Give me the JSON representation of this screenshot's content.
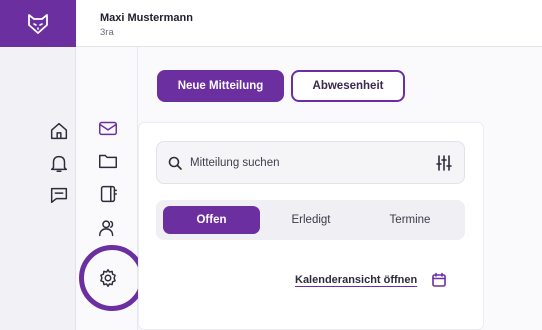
{
  "brand": {
    "logo_icon": "fox-logo-icon",
    "accent_color": "#6b2fa0"
  },
  "header": {
    "user_name": "Maxi Mustermann",
    "user_class": "3ra"
  },
  "rail_primary": [
    {
      "icon": "home-icon"
    },
    {
      "icon": "bell-icon"
    },
    {
      "icon": "chat-icon"
    }
  ],
  "rail_secondary": [
    {
      "icon": "mail-icon",
      "active": true
    },
    {
      "icon": "folder-icon"
    },
    {
      "icon": "notebook-icon"
    },
    {
      "icon": "users-icon"
    },
    {
      "icon": "gear-icon",
      "highlighted": true
    }
  ],
  "actions": {
    "new_message": "Neue Mitteilung",
    "absence": "Abwesenheit"
  },
  "search": {
    "placeholder": "Mitteilung suchen",
    "value": ""
  },
  "tabs": [
    {
      "label": "Offen",
      "active": true
    },
    {
      "label": "Erledigt"
    },
    {
      "label": "Termine"
    }
  ],
  "calendar_link": "Kalenderansicht öffnen"
}
